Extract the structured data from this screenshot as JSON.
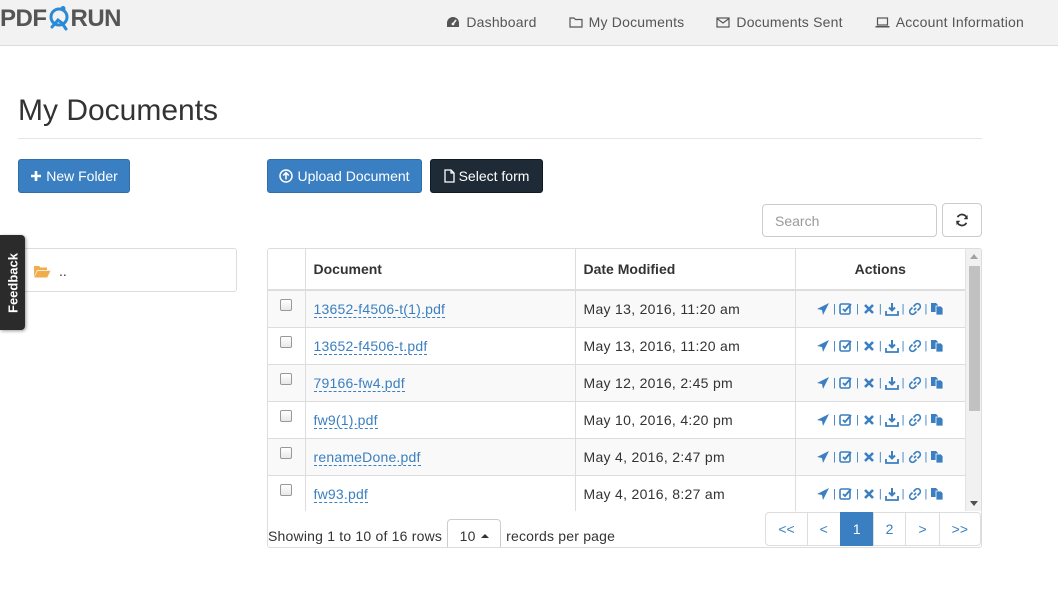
{
  "header": {
    "logo_left": "PDF",
    "logo_right": "RUN",
    "nav": [
      {
        "label": "Dashboard",
        "icon": "dashboard-icon"
      },
      {
        "label": "My Documents",
        "icon": "folder-icon"
      },
      {
        "label": "Documents Sent",
        "icon": "envelope-icon"
      },
      {
        "label": "Account Information",
        "icon": "laptop-icon"
      }
    ]
  },
  "page": {
    "title": "My Documents"
  },
  "toolbar": {
    "new_folder_label": "New Folder",
    "upload_label": "Upload Document",
    "select_form_label": "Select form",
    "search_placeholder": "Search"
  },
  "folders": {
    "items": [
      {
        "label": ".."
      }
    ]
  },
  "feedback": {
    "label": "Feedback"
  },
  "table": {
    "headers": {
      "document": "Document",
      "date": "Date Modified",
      "actions": "Actions"
    },
    "rows": [
      {
        "document": "13652-f4506-t(1).pdf",
        "date": "May 13, 2016, 11:20 am"
      },
      {
        "document": "13652-f4506-t.pdf",
        "date": "May 13, 2016, 11:20 am"
      },
      {
        "document": "79166-fw4.pdf",
        "date": "May 12, 2016, 2:45 pm"
      },
      {
        "document": "fw9(1).pdf",
        "date": "May 10, 2016, 4:20 pm"
      },
      {
        "document": "renameDone.pdf",
        "date": "May 4, 2016, 2:47 pm"
      },
      {
        "document": "fw93.pdf",
        "date": "May 4, 2016, 8:27 am"
      }
    ],
    "action_icons": [
      "send-icon",
      "edit-icon",
      "delete-icon",
      "download-icon",
      "link-icon",
      "copy-icon"
    ],
    "action_separator": "|"
  },
  "footer": {
    "showing_text": "Showing 1 to 10 of 16 rows",
    "page_size": "10",
    "records_per_page": "records per page"
  },
  "pagination": {
    "items": [
      "<<",
      "<",
      "1",
      "2",
      ">",
      ">>"
    ],
    "active": "1"
  },
  "colors": {
    "primary": "#3a7fc1",
    "dark_button": "#1e2a36",
    "folder": "#f0ad4e"
  }
}
